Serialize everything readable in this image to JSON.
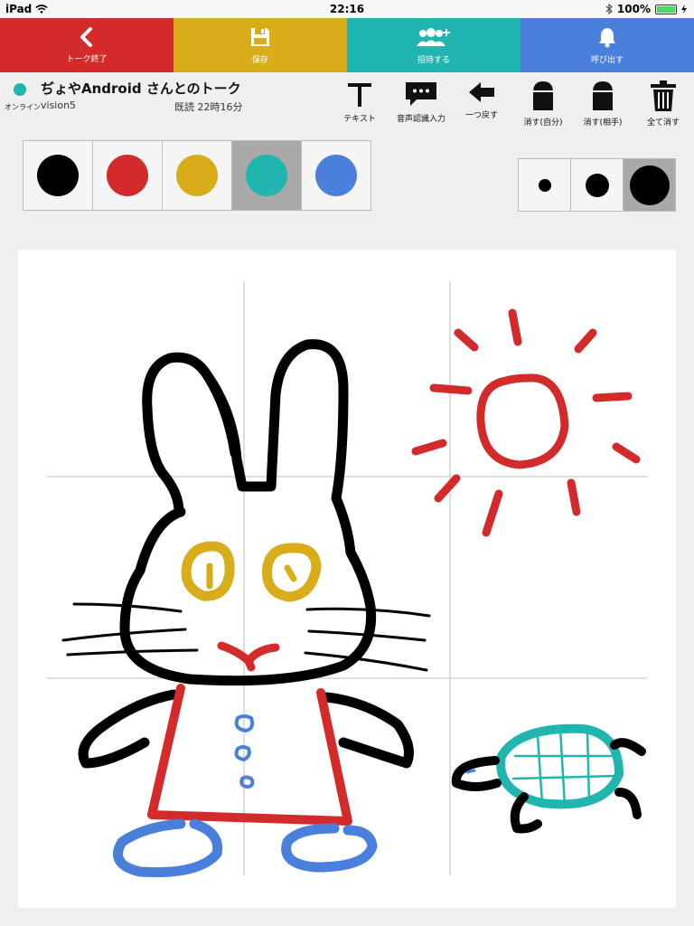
{
  "status_bar": {
    "device": "iPad",
    "time": "22:16",
    "battery": "100%"
  },
  "top_toolbar": [
    {
      "label": "トーク終了",
      "icon": "chevron-left-icon",
      "color": "#d32b2b"
    },
    {
      "label": "保存",
      "icon": "floppy-disk-icon",
      "color": "#d9ac1a"
    },
    {
      "label": "招待する",
      "icon": "add-group-icon",
      "color": "#20b5ae"
    },
    {
      "label": "呼び出す",
      "icon": "bell-icon",
      "color": "#4a80dc"
    }
  ],
  "chat": {
    "title": "ぢょやAndroid さんとのトーク",
    "status": "オンライン",
    "user": "vision5",
    "read": "既読 22時16分"
  },
  "tools": [
    {
      "label": "テキスト",
      "icon": "text-icon"
    },
    {
      "label": "音声認識入力",
      "icon": "speech-bubble-icon"
    },
    {
      "label": "一つ戻す",
      "icon": "undo-arrow-icon"
    },
    {
      "label": "消す(自分)",
      "icon": "eraser-self-icon"
    },
    {
      "label": "消す(相手)",
      "icon": "eraser-other-icon"
    },
    {
      "label": "全て消す",
      "icon": "trash-icon"
    }
  ],
  "palette": {
    "colors": [
      "#000000",
      "#d32b2b",
      "#d9ac1a",
      "#20b5ae",
      "#4a80dc"
    ],
    "selected": "#20b5ae"
  },
  "pen_sizes": {
    "options": [
      "small",
      "medium",
      "large"
    ],
    "selected": "large"
  }
}
